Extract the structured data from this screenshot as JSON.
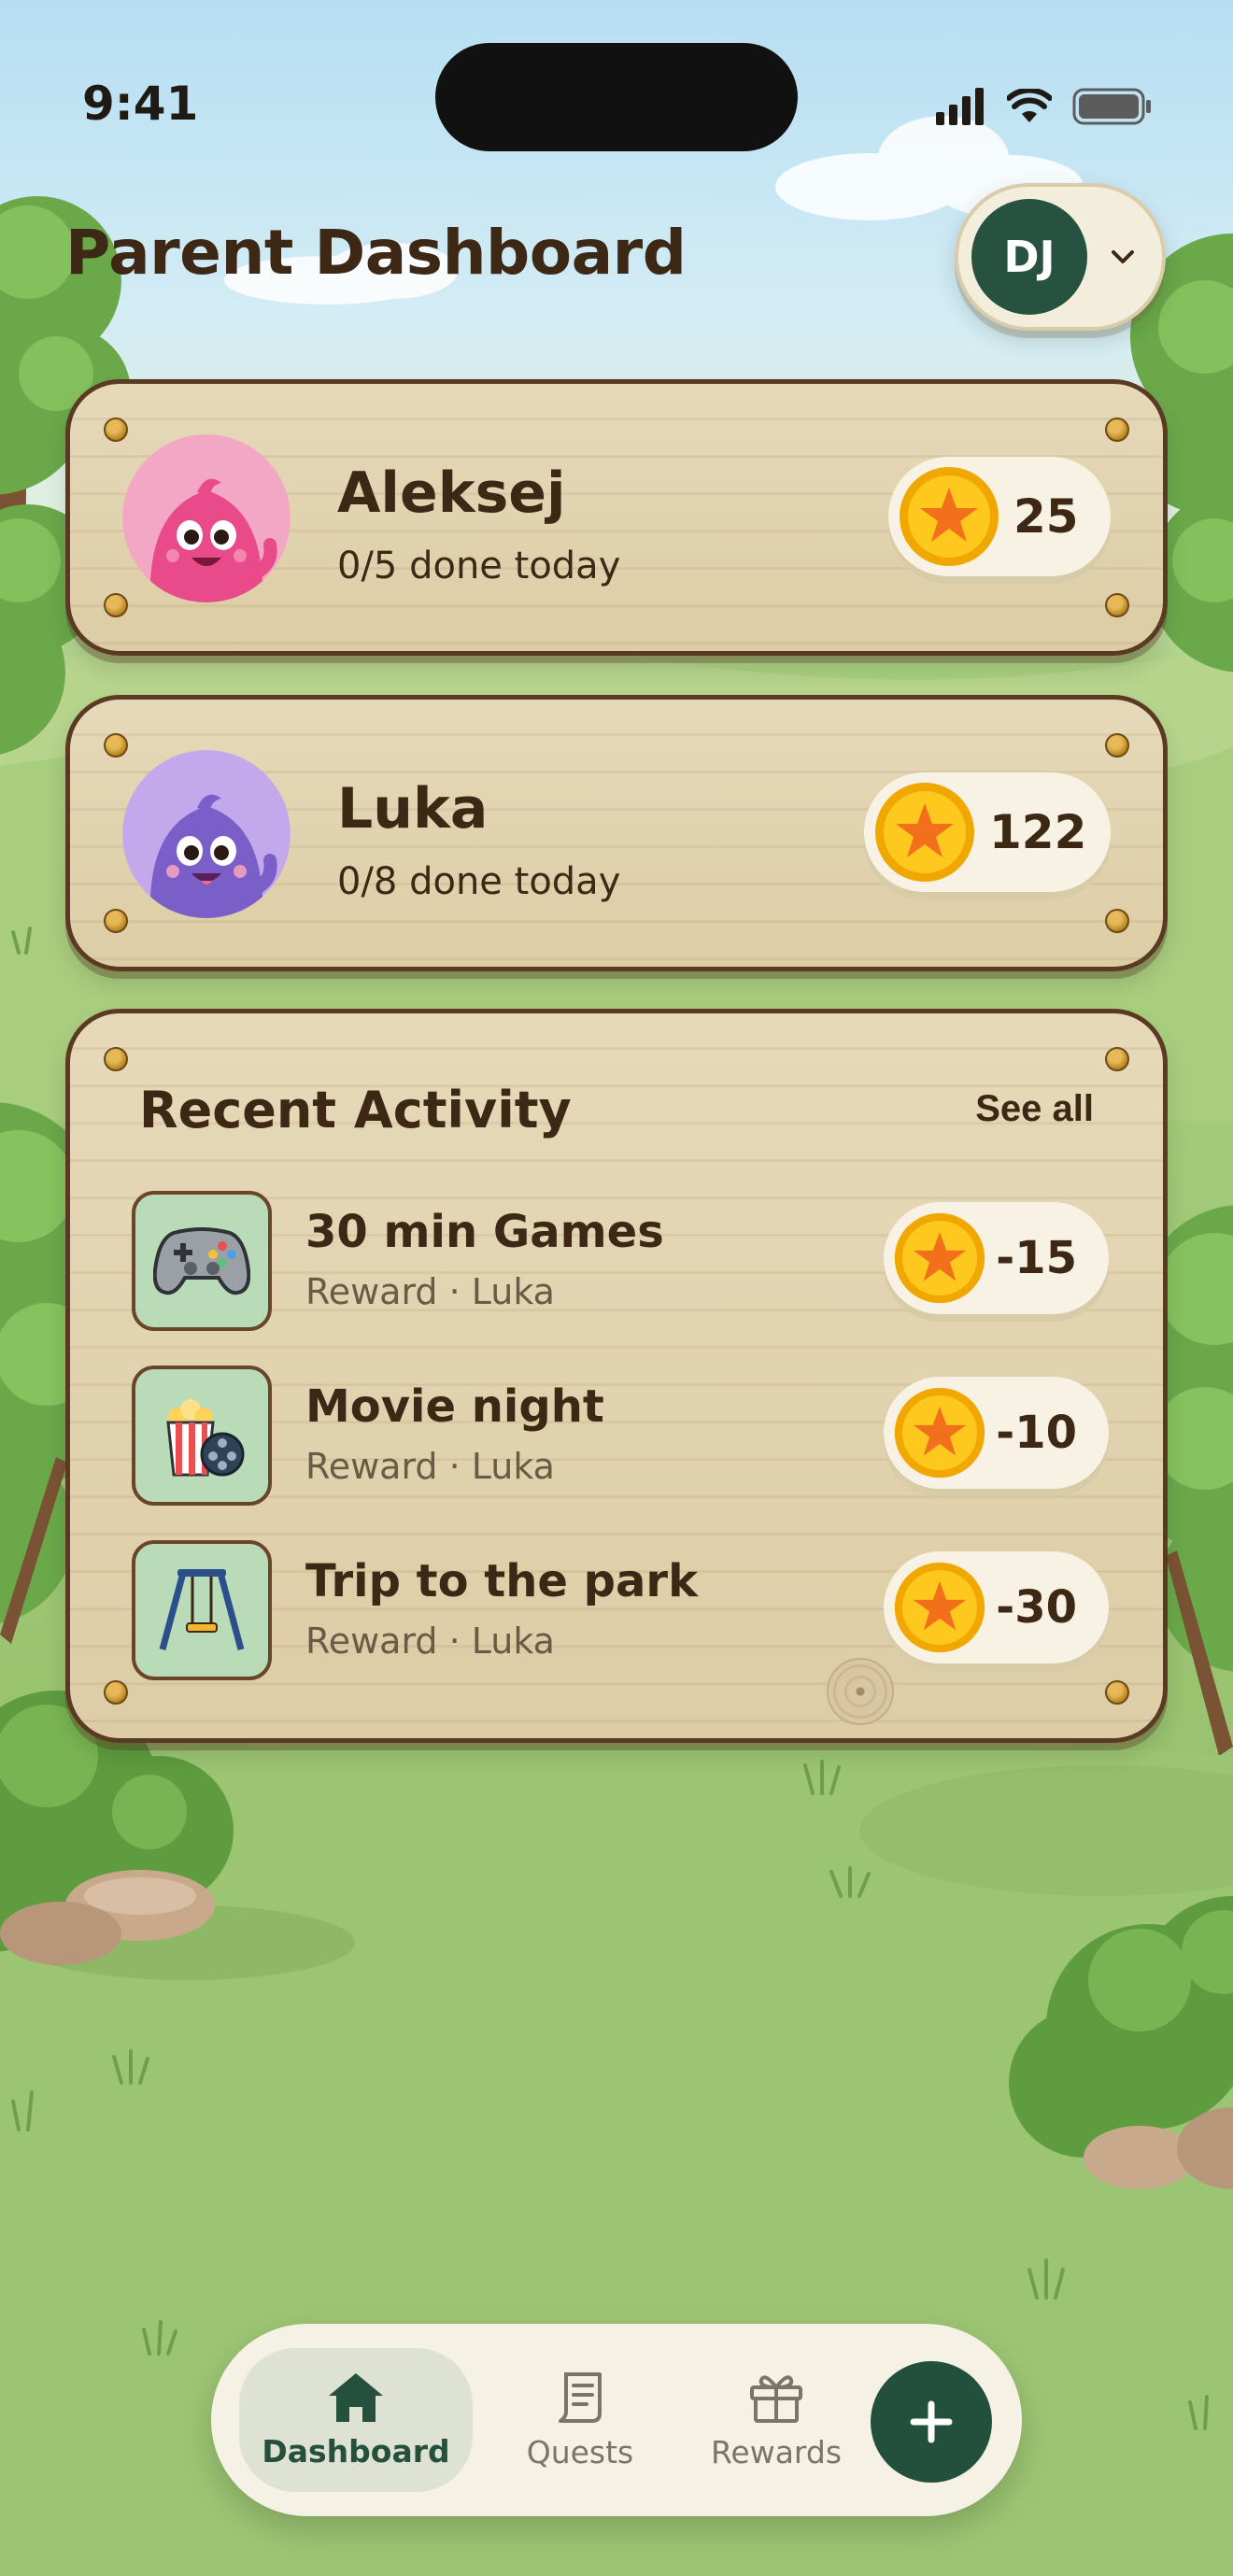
{
  "status_bar": {
    "time": "9:41"
  },
  "header": {
    "title": "Parent Dashboard",
    "profile_initials": "DJ"
  },
  "kids": [
    {
      "name": "Aleksej",
      "progress": "0/5 done today",
      "coins": "25",
      "avatar_color": "#f2a8c4"
    },
    {
      "name": "Luka",
      "progress": "0/8 done today",
      "coins": "122",
      "avatar_color": "#c4a8ec"
    }
  ],
  "activity": {
    "title": "Recent Activity",
    "see_all": "See all",
    "items": [
      {
        "name": "30 min Games",
        "meta": "Reward · Luka",
        "amount": "-15",
        "icon": "game-controller-icon"
      },
      {
        "name": "Movie night",
        "meta": "Reward · Luka",
        "amount": "-10",
        "icon": "popcorn-film-icon"
      },
      {
        "name": "Trip to the park",
        "meta": "Reward · Luka",
        "amount": "-30",
        "icon": "swing-icon"
      }
    ]
  },
  "nav": {
    "dashboard": "Dashboard",
    "quests": "Quests",
    "rewards": "Rewards"
  },
  "colors": {
    "wood": "#e6d9b9",
    "wood_border": "#5a3a22",
    "accent_green": "#23503c",
    "coin_gold": "#f5b90f",
    "text_brown": "#3d2816"
  }
}
